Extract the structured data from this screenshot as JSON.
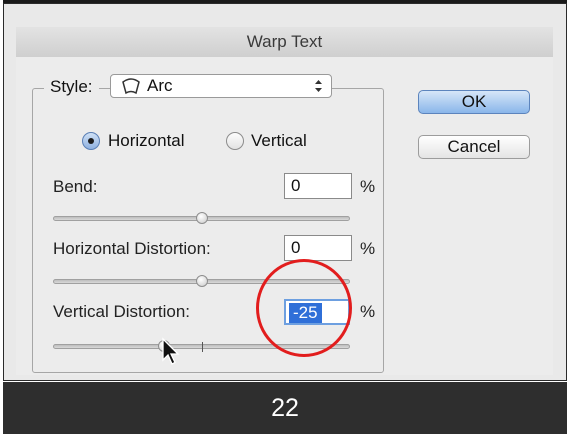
{
  "dialog": {
    "title": "Warp Text",
    "style_label": "Style:",
    "style_value": "Arc",
    "orientation": {
      "horizontal_label": "Horizontal",
      "vertical_label": "Vertical",
      "selected": "Horizontal"
    },
    "bend": {
      "label": "Bend:",
      "value": "0",
      "unit": "%",
      "slider_fraction": 0.5
    },
    "horizontal_distortion": {
      "label": "Horizontal Distortion:",
      "value": "0",
      "unit": "%",
      "slider_fraction": 0.5
    },
    "vertical_distortion": {
      "label": "Vertical Distortion:",
      "value": "-25",
      "unit": "%",
      "slider_fraction": 0.375
    },
    "ok_label": "OK",
    "cancel_label": "Cancel"
  },
  "annotation": {
    "circle_color": "#e21d1d"
  },
  "caption": {
    "page_number": "22"
  },
  "icons": [
    "arc-warp-icon",
    "select-updown-icon",
    "mouse-pointer-icon"
  ]
}
